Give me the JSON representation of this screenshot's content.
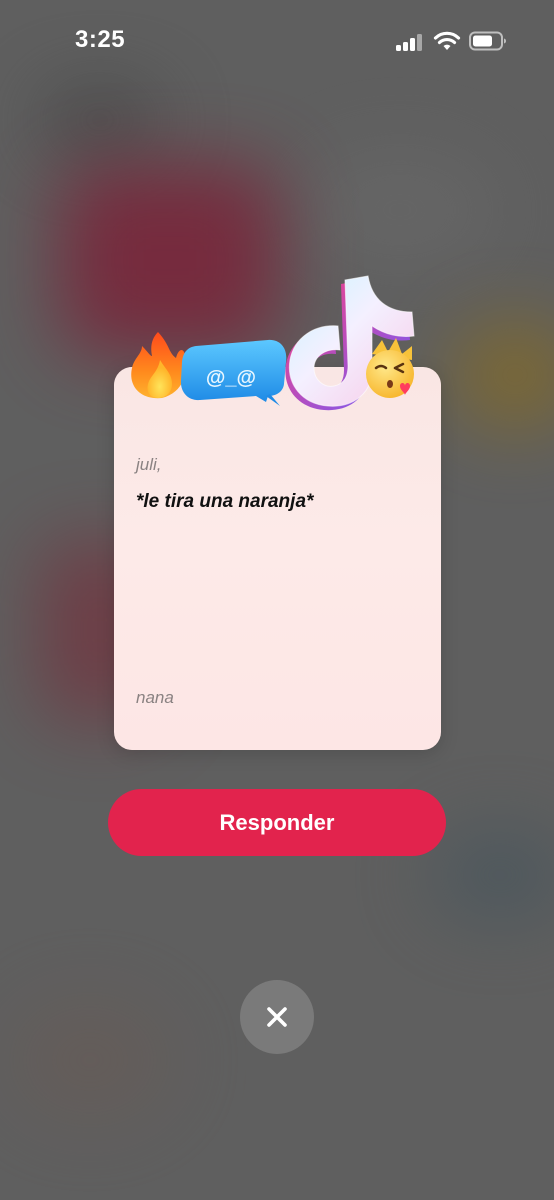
{
  "status_bar": {
    "time": "3:25",
    "signal_icon": "cellular-signal-icon",
    "wifi_icon": "wifi-icon",
    "battery_icon": "battery-icon"
  },
  "stickers": [
    "fire-sticker",
    "chat-bubble-sticker",
    "tiktok-logo-sticker",
    "kissing-face-sticker"
  ],
  "chat_bubble_text": "@_@",
  "card": {
    "greeting": "juli,",
    "message": "*le tira una naranja*",
    "signature": "nana"
  },
  "actions": {
    "respond_label": "Responder",
    "close_icon": "close-icon"
  },
  "colors": {
    "accent": "#e2234d",
    "card_background": "#fde8e6",
    "overlay": "#5f5f5f"
  }
}
